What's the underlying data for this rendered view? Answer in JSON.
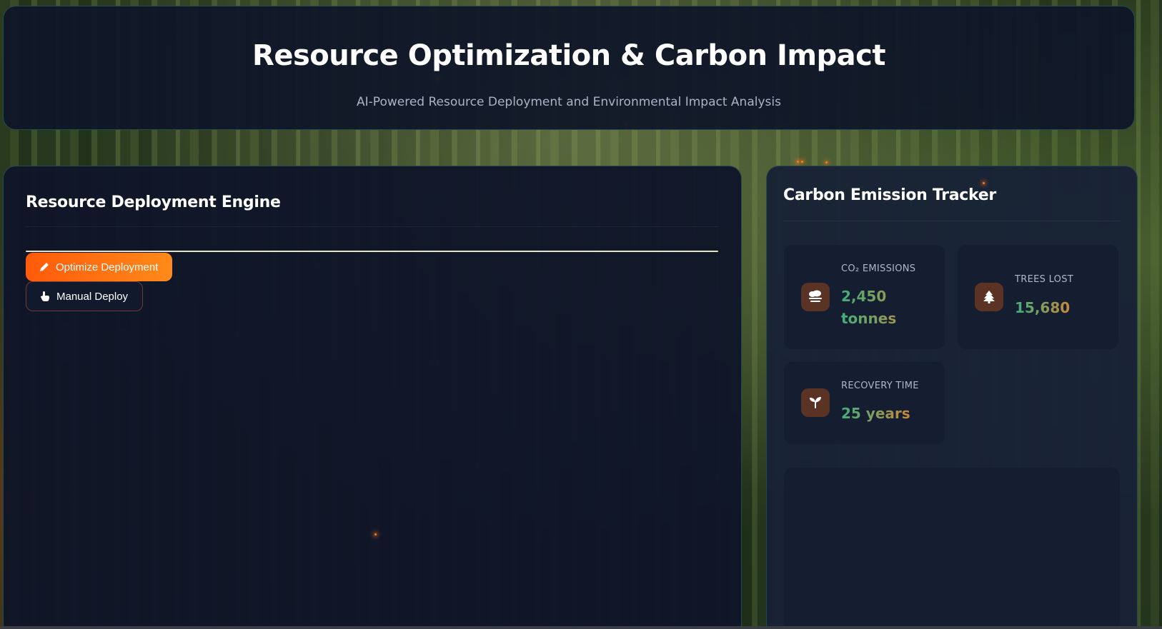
{
  "header": {
    "title": "Resource Optimization & Carbon Impact",
    "subtitle": "AI-Powered Resource Deployment and Environmental Impact Analysis"
  },
  "deployment": {
    "title": "Resource Deployment Engine",
    "optimize_label": "Optimize Deployment",
    "manual_label": "Manual Deploy",
    "icons": {
      "optimize": "pencil-icon",
      "manual": "hand-pointer-icon"
    }
  },
  "carbon": {
    "title": "Carbon Emission Tracker",
    "stats": [
      {
        "label": "CO₂ EMISSIONS",
        "value": "2,450 tonnes",
        "icon": "smog-icon"
      },
      {
        "label": "TREES LOST",
        "value": "15,680",
        "icon": "tree-icon"
      },
      {
        "label": "RECOVERY TIME",
        "value": "25 years",
        "icon": "seedling-icon"
      }
    ]
  },
  "colors": {
    "accent_orange": "#ff5a0a",
    "accent_orange_end": "#ff8a1a",
    "value_green": "#3fb07a",
    "value_amber": "#c8883a",
    "panel_bg": "#0f1628"
  }
}
